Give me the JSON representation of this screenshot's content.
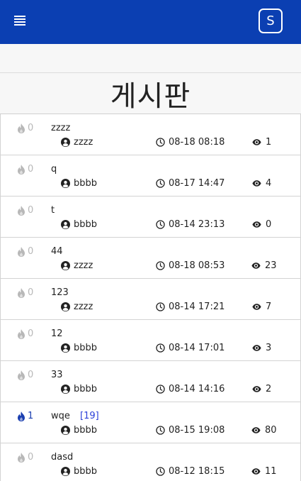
{
  "header": {
    "menu_icon": "hamburger-menu-icon",
    "avatar_letter": "S",
    "brand_color": "#0b3fb2"
  },
  "page": {
    "title": "게시판"
  },
  "posts": [
    {
      "likes": "0",
      "liked": false,
      "title": "zzzz",
      "comments": "",
      "author": "zzzz",
      "date": "08-18 08:18",
      "views": "1"
    },
    {
      "likes": "0",
      "liked": false,
      "title": "q",
      "comments": "",
      "author": "bbbb",
      "date": "08-17 14:47",
      "views": "4"
    },
    {
      "likes": "0",
      "liked": false,
      "title": "t",
      "comments": "",
      "author": "bbbb",
      "date": "08-14 23:13",
      "views": "0"
    },
    {
      "likes": "0",
      "liked": false,
      "title": "44",
      "comments": "",
      "author": "zzzz",
      "date": "08-18 08:53",
      "views": "23"
    },
    {
      "likes": "0",
      "liked": false,
      "title": "123",
      "comments": "",
      "author": "zzzz",
      "date": "08-14 17:21",
      "views": "7"
    },
    {
      "likes": "0",
      "liked": false,
      "title": "12",
      "comments": "",
      "author": "bbbb",
      "date": "08-14 17:01",
      "views": "3"
    },
    {
      "likes": "0",
      "liked": false,
      "title": "33",
      "comments": "",
      "author": "bbbb",
      "date": "08-14 14:16",
      "views": "2"
    },
    {
      "likes": "1",
      "liked": true,
      "title": "wqe",
      "comments": "[19]",
      "author": "bbbb",
      "date": "08-15 19:08",
      "views": "80"
    },
    {
      "likes": "0",
      "liked": false,
      "title": "dasd",
      "comments": "",
      "author": "bbbb",
      "date": "08-12 18:15",
      "views": "11"
    }
  ],
  "icons": {
    "like": "flame-icon",
    "author": "user-circle-icon",
    "date": "clock-icon",
    "views": "eye-icon"
  },
  "colors": {
    "liked": "#1b3fb0",
    "unliked": "#b8b8b8",
    "comment_count": "#2a3fd8"
  }
}
